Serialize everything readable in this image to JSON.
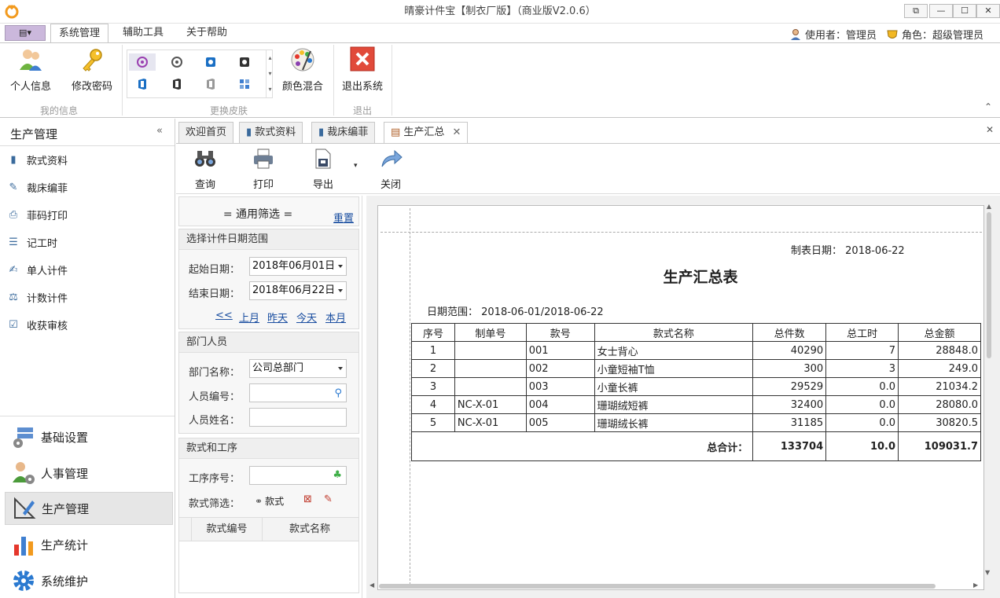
{
  "window": {
    "title": "晴豪计件宝【制衣厂版】（商业版V2.0.6）"
  },
  "ribbon": {
    "quick_access_label": "▾",
    "tabs": [
      "系统管理",
      "辅助工具",
      "关于帮助"
    ],
    "user_label": "使用者：管理员",
    "role_label": "角色：超级管理员",
    "buttons": {
      "personal": "个人信息",
      "password": "修改密码",
      "color_mix": "颜色混合",
      "exit": "退出系统"
    },
    "groups": {
      "my_info": "我的信息",
      "skins": "更换皮肤",
      "exit": "退出"
    }
  },
  "left_nav": {
    "title": "生产管理",
    "items": [
      "款式资料",
      "裁床编菲",
      "菲码打印",
      "记工时",
      "单人计件",
      "计数计件",
      "收获审核"
    ],
    "modules": [
      "基础设置",
      "人事管理",
      "生产管理",
      "生产统计",
      "系统维护"
    ]
  },
  "doc_tabs": [
    "欢迎首页",
    "款式资料",
    "裁床编菲",
    "生产汇总"
  ],
  "toolbar": {
    "query": "查询",
    "print": "打印",
    "export": "导出",
    "close": "关闭"
  },
  "filter": {
    "title": "= 通用筛选 =",
    "reset": "重置",
    "date_section": "选择计件日期范围",
    "start_label": "起始日期：",
    "start_value": "2018年06月01日",
    "end_label": "结束日期：",
    "end_value": "2018年06月22日",
    "quick_links": [
      "<<",
      "上月",
      "昨天",
      "今天",
      "本月"
    ],
    "dept_section": "部门人员",
    "dept_label": "部门名称：",
    "dept_value": "公司总部门",
    "staff_no_label": "人员编号：",
    "staff_name_label": "人员姓名：",
    "style_section": "款式和工序",
    "process_label": "工序序号：",
    "style_filter_label": "款式筛选：",
    "style_btn": "款式",
    "grid_headers": [
      "款式编号",
      "款式名称"
    ]
  },
  "report": {
    "made_date_label": "制表日期：",
    "made_date": "2018-06-22",
    "title": "生产汇总表",
    "range_label": "日期范围：",
    "range_value": "2018-06-01/2018-06-22",
    "headers": [
      "序号",
      "制单号",
      "款号",
      "款式名称",
      "总件数",
      "总工时",
      "总金额"
    ],
    "rows": [
      [
        "1",
        "",
        "001",
        "女士背心",
        "40290",
        "7",
        "28848.0"
      ],
      [
        "2",
        "",
        "002",
        "小童短袖T恤",
        "300",
        "3",
        "249.0"
      ],
      [
        "3",
        "",
        "003",
        "小童长裤",
        "29529",
        "0.0",
        "21034.2"
      ],
      [
        "4",
        "NC-X-01",
        "004",
        "珊瑚绒短裤",
        "32400",
        "0.0",
        "28080.0"
      ],
      [
        "5",
        "NC-X-01",
        "005",
        "珊瑚绒长裤",
        "31185",
        "0.0",
        "30820.5"
      ]
    ],
    "total_label": "总合计：",
    "total_pieces": "133704",
    "total_hours": "10.0",
    "total_amount": "109031.7"
  }
}
